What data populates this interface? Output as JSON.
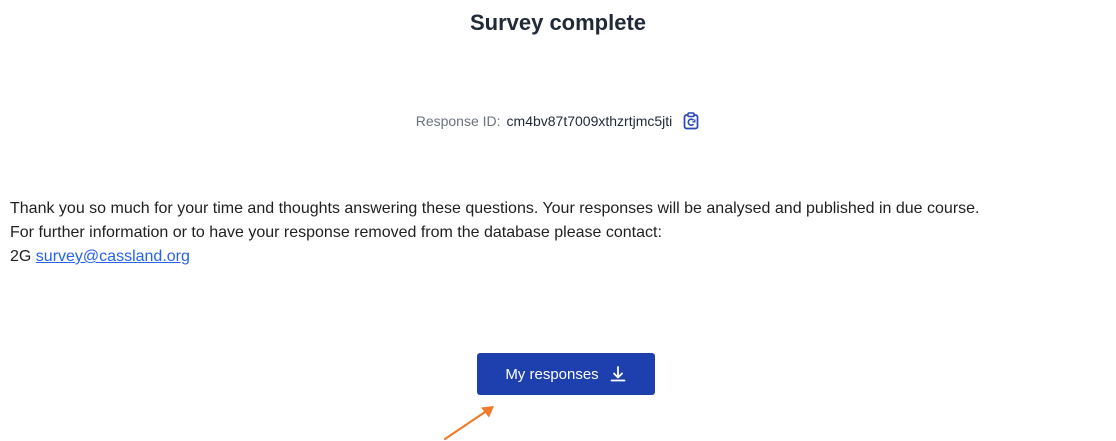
{
  "header": {
    "title": "Survey complete"
  },
  "response": {
    "label": "Response ID:",
    "id": "cm4bv87t7009xthzrtjmc5jti",
    "copy_icon": "copy-icon"
  },
  "message": {
    "line1": "Thank you so much for your time and thoughts answering these questions. Your responses will be analysed and published in due course.",
    "line2": "For further information or to have your response removed from the database please contact:",
    "contact_prefix": "2G",
    "contact_email": "survey@cassland.org"
  },
  "actions": {
    "my_responses_label": "My responses",
    "download_icon": "download-icon"
  },
  "colors": {
    "button": "#1e40af",
    "link": "#2563eb",
    "annotation_arrow": "#f07a2a"
  }
}
